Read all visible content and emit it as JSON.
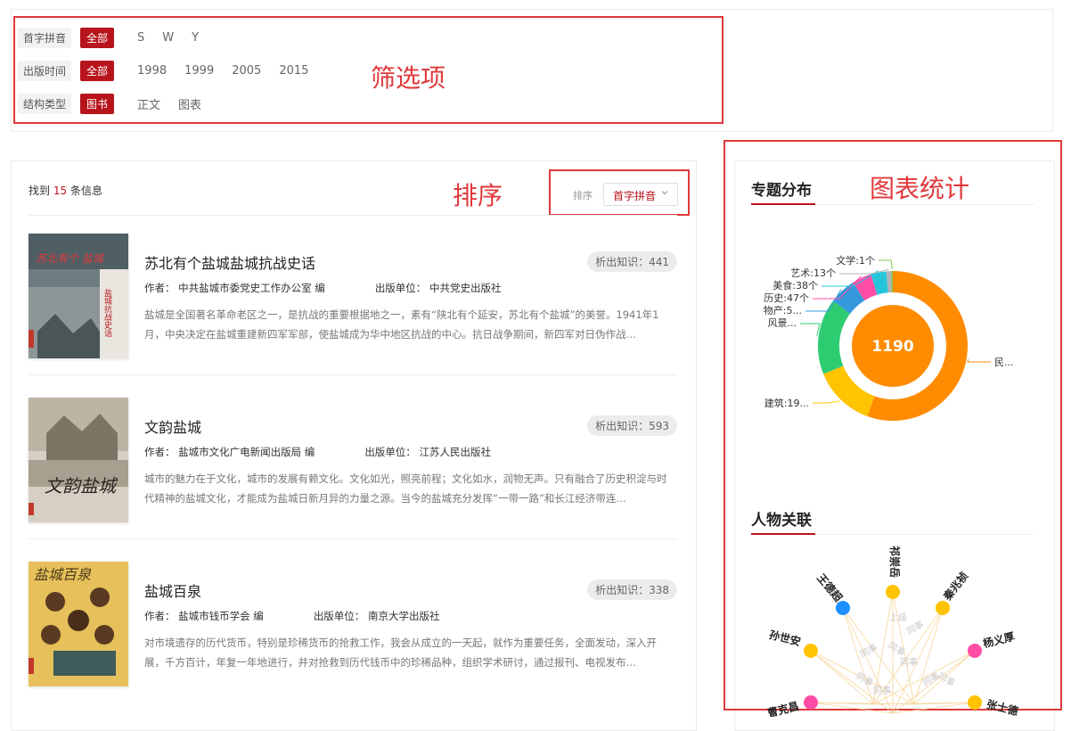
{
  "filters": [
    {
      "label": "首字拼音",
      "all": "全部",
      "options": [
        "S",
        "W",
        "Y"
      ]
    },
    {
      "label": "出版时间",
      "all": "全部",
      "options": [
        "1998",
        "1999",
        "2005",
        "2015"
      ]
    },
    {
      "label": "结构类型",
      "all": "图书",
      "options": [
        "正文",
        "图表"
      ]
    }
  ],
  "annotations": {
    "filter": "筛选项",
    "sort": "排序",
    "stats": "图表统计"
  },
  "results": {
    "prefix": "找到",
    "count": "15",
    "suffix": "条信息"
  },
  "sort": {
    "label": "排序",
    "value": "首字拼音"
  },
  "books": [
    {
      "title": "苏北有个盐城盐城抗战史话",
      "badge": "析出知识：441",
      "author": "作者：  中共盐城市委党史工作办公室 编",
      "publisher": "出版单位：  中共党史出版社",
      "desc": "盐城是全国著名革命老区之一，是抗战的重要根据地之一，素有“陕北有个延安，苏北有个盐城”的美誉。1941年1月，中央决定在盐城重建新四军军部，使盐城成为华中地区抗战的中心。抗日战争期间，新四军对日伪作战…",
      "cover_text": "苏北有个 盐城",
      "cover_sub": "盐城抗战史话",
      "cover_colors": [
        "#3c4a4e",
        "#9aa4a8"
      ]
    },
    {
      "title": "文韵盐城",
      "badge": "析出知识：593",
      "author": "作者：  盐城市文化广电新闻出版局 编",
      "publisher": "出版单位：  江苏人民出版社",
      "desc": "城市的魅力在于文化，城市的发展有赖文化。文化如光，照亮前程；文化如水，润物无声。只有融合了历史积淀与时代精神的盐城文化，才能成为盐城日新月异的力量之源。当今的盐城充分发挥“一带一路”和长江经济带连…",
      "cover_text": "文韵盐城",
      "cover_sub": "",
      "cover_colors": [
        "#d9d2c7",
        "#8f8577"
      ]
    },
    {
      "title": "盐城百泉",
      "badge": "析出知识：338",
      "author": "作者：  盐城市钱币学会 编",
      "publisher": "出版单位：  南京大学出版社",
      "desc": "对市境遗存的历代货币，特别是珍稀货币的抢救工作，我会从成立的一天起，就作为重要任务，全面发动，深入开展，千方百计，年复一年地进行，并对抢救到历代钱币中的珍稀品种，组织学术研讨，通过报刊、电视发布…",
      "cover_text": "盐城百泉",
      "cover_sub": "",
      "cover_colors": [
        "#e8c35a",
        "#c49a33"
      ]
    }
  ],
  "stats": {
    "topic_title": "专题分布",
    "relation_title": "人物关联"
  },
  "chart_data": {
    "type": "pie",
    "center_label": "1190",
    "slices": [
      {
        "label": "民...",
        "color": "#ff8c00"
      },
      {
        "label": "建筑:19...",
        "color": "#ffc300"
      },
      {
        "label": "风景...",
        "color": "#2ecc71"
      },
      {
        "label": "物产:5...",
        "color": "#3498db"
      },
      {
        "label": "历史:47个",
        "value": 47,
        "color": "#ff4da6"
      },
      {
        "label": "美食:38个",
        "value": 38,
        "color": "#26c6da"
      },
      {
        "label": "艺术:13个",
        "value": 13,
        "color": "#b3b3b3"
      },
      {
        "label": "文学:1个",
        "value": 1,
        "color": "#7ac943"
      }
    ]
  },
  "graph": {
    "nodes": [
      {
        "name": "王德超",
        "color": "#1e90ff"
      },
      {
        "name": "祁崇岳",
        "color": "#ffc300"
      },
      {
        "name": "秦兆祯",
        "color": "#ffc300"
      },
      {
        "name": "杨义厚",
        "color": "#ff4da6"
      },
      {
        "name": "孙世安",
        "color": "#ffc300"
      },
      {
        "name": "张士德",
        "color": "#ffc300"
      },
      {
        "name": "曹克昌",
        "color": "#ff4da6"
      }
    ],
    "edge_labels": [
      "同事",
      "上级",
      "同事",
      "同事",
      "同事",
      "同事",
      "同事",
      "同事",
      "同事"
    ]
  }
}
